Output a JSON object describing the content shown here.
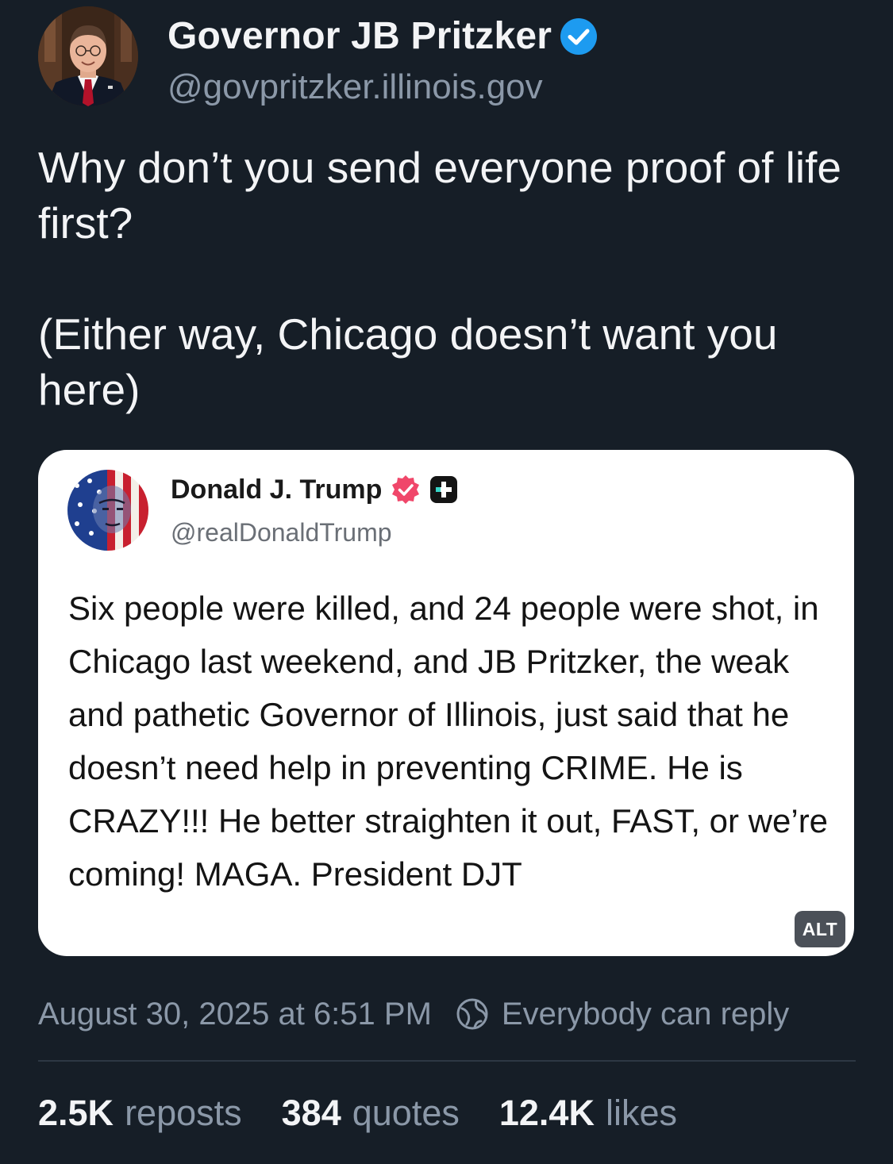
{
  "author": {
    "name": "Governor JB Pritzker",
    "handle": "@govpritzker.illinois.gov",
    "verified_color": "#1d9bf0"
  },
  "post": {
    "paragraphs": [
      "Why don’t you send everyone proof of life first?",
      "(Either way, Chicago doesn’t want you here)"
    ]
  },
  "embed": {
    "name": "Donald J. Trump",
    "handle": "@realDonaldTrump",
    "badge_color": "#f0476a",
    "text": "Six people were killed, and 24 people were shot, in Chicago last weekend, and JB Pritzker, the weak and pathetic Governor of Illinois, just said that he doesn’t need help in preventing CRIME. He is CRAZY!!! He better straighten it out, FAST, or we’re coming! MAGA. President DJT",
    "alt_label": "ALT"
  },
  "meta": {
    "timestamp": "August 30, 2025 at 6:51 PM",
    "reply_setting": "Everybody can reply"
  },
  "stats": {
    "reposts_count": "2.5K",
    "reposts_label": "reposts",
    "quotes_count": "384",
    "quotes_label": "quotes",
    "likes_count": "12.4K",
    "likes_label": "likes"
  }
}
